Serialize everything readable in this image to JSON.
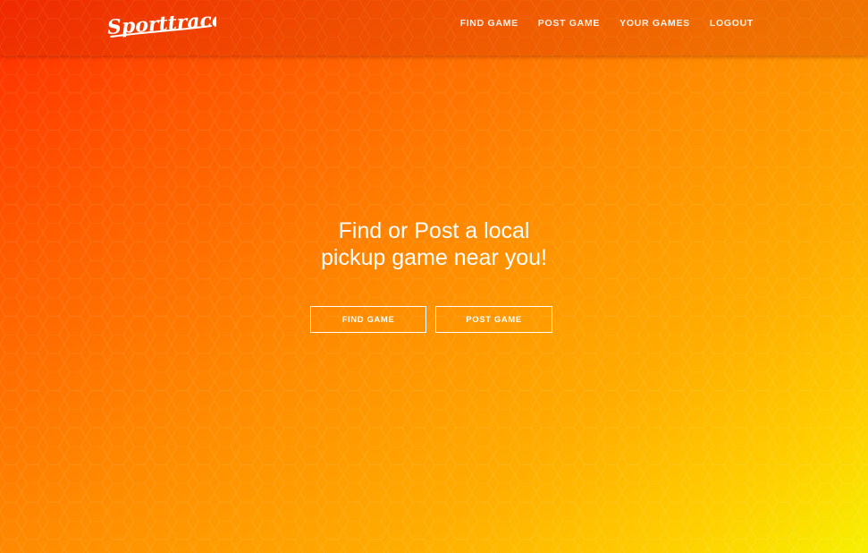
{
  "brand": {
    "logo_text": "Sporttrace"
  },
  "nav": {
    "items": [
      {
        "label": "FIND GAME"
      },
      {
        "label": "POST GAME"
      },
      {
        "label": "YOUR GAMES"
      },
      {
        "label": "LOGOUT"
      }
    ]
  },
  "hero": {
    "title_line1": "Find or Post a local",
    "title_line2": "pickup game near you!",
    "find_button": "FIND GAME",
    "post_button": "POST GAME"
  },
  "colors": {
    "gradient_start": "#ff2a00",
    "gradient_mid": "#ff8a00",
    "gradient_end": "#f7f000",
    "text": "#ffffff"
  }
}
